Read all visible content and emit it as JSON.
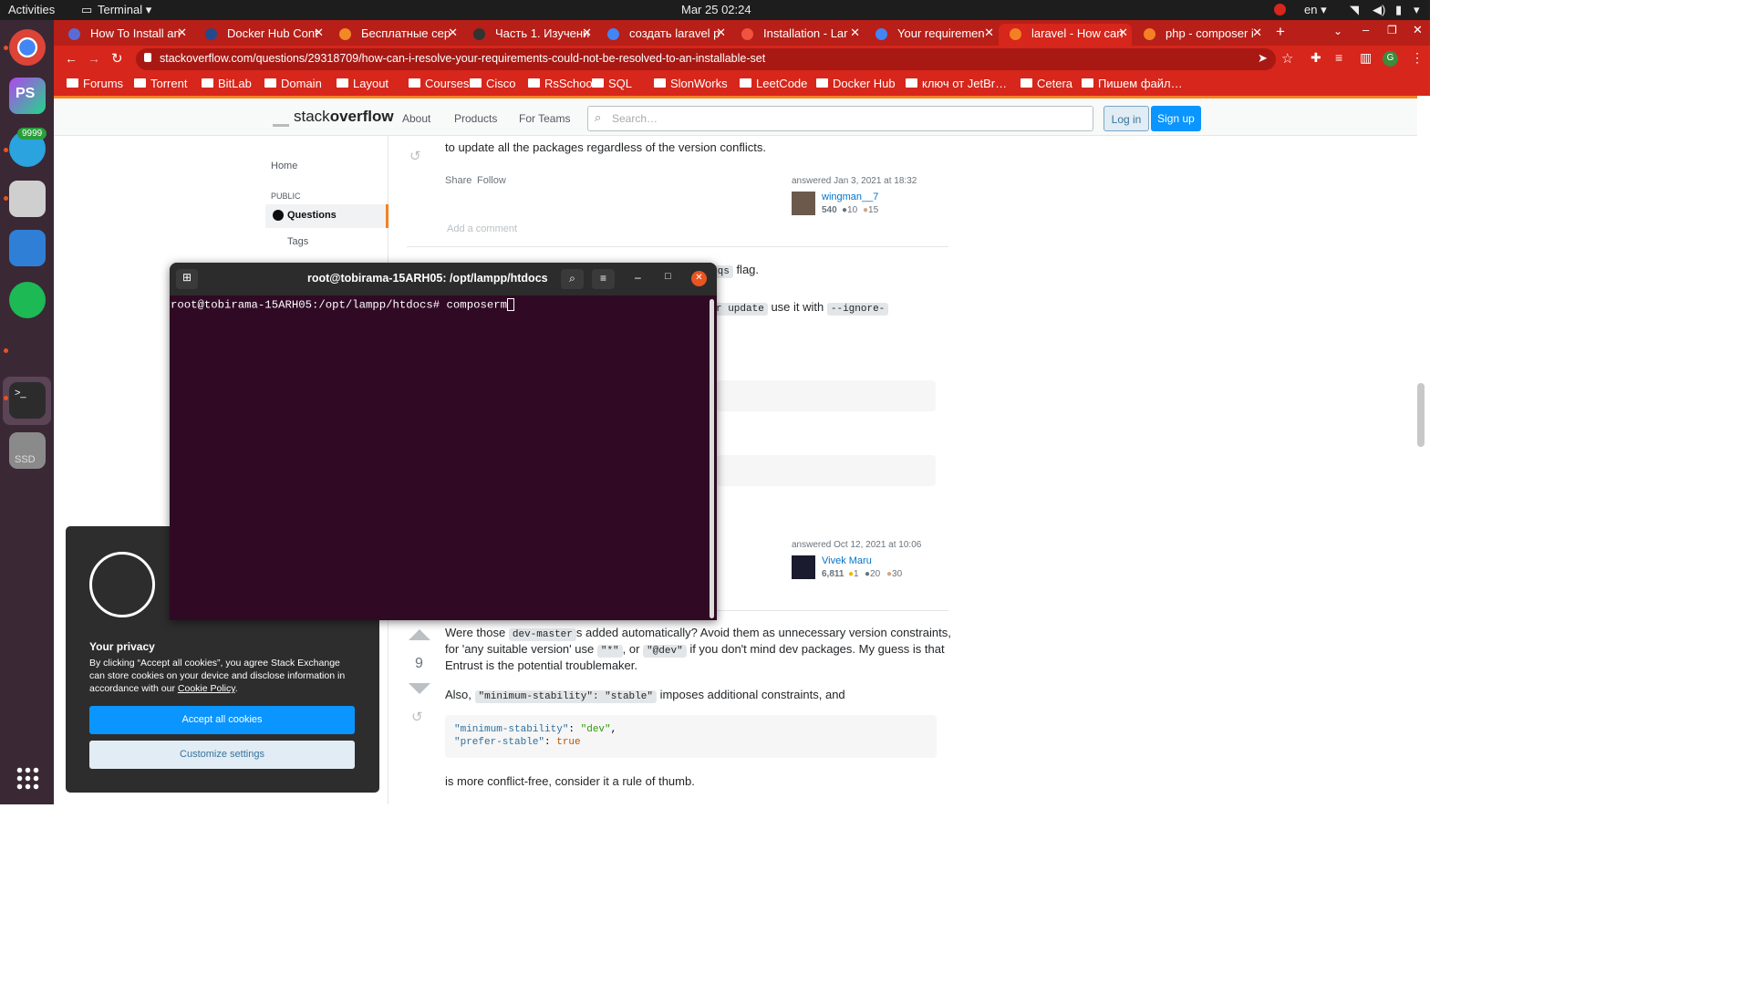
{
  "system": {
    "activities": "Activities",
    "app_menu": "Terminal ▾",
    "datetime": "Mar 25  02:24",
    "lang": "en ▾"
  },
  "dock": {
    "badge": "9999",
    "ssd": "SSD"
  },
  "tabs": [
    {
      "label": "How To Install an"
    },
    {
      "label": "Docker Hub Cont"
    },
    {
      "label": "Бесплатные сер"
    },
    {
      "label": "Часть 1. Изучени"
    },
    {
      "label": "создать laravel p"
    },
    {
      "label": "Installation - Lar"
    },
    {
      "label": "Your requiremen"
    },
    {
      "label": "laravel - How can"
    },
    {
      "label": "php - composer i"
    }
  ],
  "address": {
    "url": "stackoverflow.com/questions/29318709/how-can-i-resolve-your-requirements-could-not-be-resolved-to-an-installable-set"
  },
  "bookmarks": [
    "Forums",
    "Torrent",
    "BitLab",
    "Domain",
    "Layout",
    "Courses",
    "Cisco",
    "RsSchool",
    "SQL",
    "SlonWorks",
    "LeetCode",
    "Docker Hub",
    "ключ от JetBr…",
    "Cetera",
    "Пишем файл…"
  ],
  "so": {
    "logo_a": "stack",
    "logo_b": "overflow",
    "about": "About",
    "products": "Products",
    "teams": "For Teams",
    "search_placeholder": "Search…",
    "login": "Log in",
    "signup": "Sign up"
  },
  "leftnav": {
    "home": "Home",
    "public": "PUBLIC",
    "questions": "Questions",
    "tags": "Tags"
  },
  "answer1": {
    "text": "to update all the packages regardless of the version conflicts.",
    "share": "Share",
    "follow": "Follow",
    "answered": "answered Jan 3, 2021 at 18:32",
    "user": "wingman__7",
    "rep": "540",
    "silver": "10",
    "bronze": "15",
    "add_comment": "Add a comment"
  },
  "answer2": {
    "frag_flag_code": "eqs",
    "frag_flag": "flag.",
    "frag_update_code": "r update",
    "frag_use": "use it with",
    "frag_ignore": "--ignore-",
    "answered": "answered Oct 12, 2021 at 10:06",
    "user": "Vivek Maru",
    "rep": "6,811",
    "gold": "1",
    "silver": "20",
    "bronze": "30"
  },
  "answer3": {
    "votes": "9",
    "l1a": "Were those",
    "l1code": "dev-master",
    "l1b": "s added automatically? Avoid them as unnecessary version constraints,",
    "l2a": "for 'any suitable version' use",
    "l2code1": "\"*\"",
    "l2b": ", or",
    "l2code2": "\"@dev\"",
    "l2c": "if you don't mind dev packages. My guess is that",
    "l3": "Entrust is the potential troublemaker.",
    "l4a": "Also,",
    "l4code": "\"minimum-stability\": \"stable\"",
    "l4b": "imposes additional constraints, and",
    "code_l1k": "\"minimum-stability\"",
    "code_l1v": "\"dev\"",
    "code_l2k": "\"prefer-stable\"",
    "code_l2v": "true",
    "l5": "is more conflict-free, consider it a rule of thumb."
  },
  "cookie": {
    "title": "Your privacy",
    "body1": "By clicking “Accept all cookies”, you agree Stack Exchange",
    "body2": "can store cookies on your device and disclose information in",
    "body3": "accordance with our",
    "policy": "Cookie Policy",
    "accept": "Accept all cookies",
    "customize": "Customize settings"
  },
  "terminal": {
    "title": "root@tobirama-15ARH05: /opt/lampp/htdocs",
    "line": "root@tobirama-15ARH05:/opt/lampp/htdocs# composerm"
  }
}
